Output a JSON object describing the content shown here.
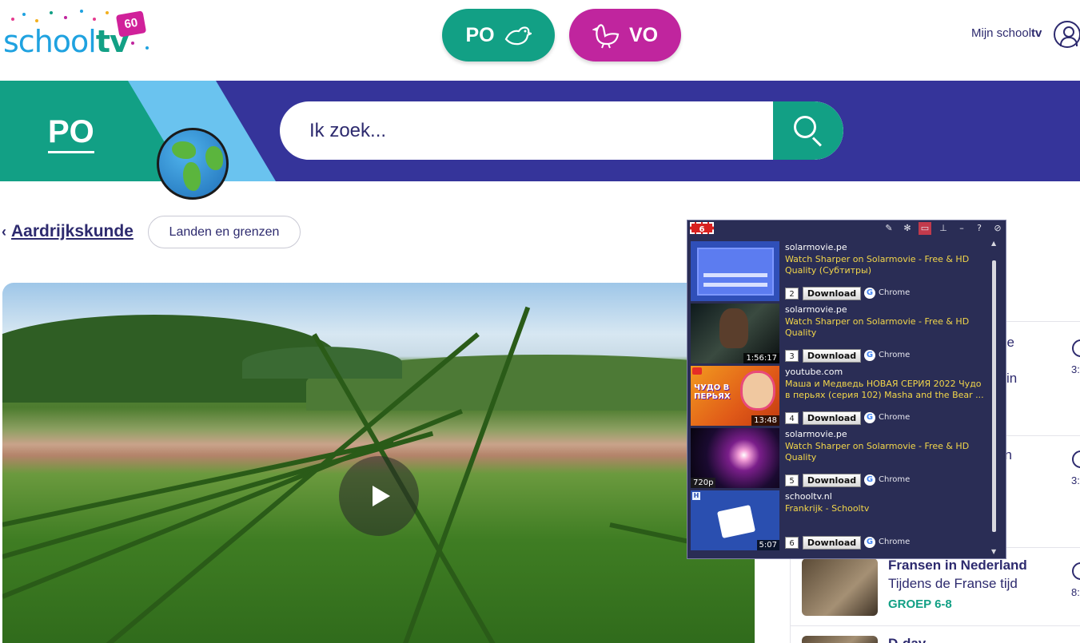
{
  "header": {
    "logo_text_a": "school",
    "logo_text_b": "tv",
    "logo_badge": "60",
    "po_label": "PO",
    "vo_label": "VO",
    "mijn_a": "Mijn school",
    "mijn_b": "tv"
  },
  "banner": {
    "po_label": "PO",
    "search_placeholder": "Ik zoek..."
  },
  "breadcrumb": {
    "back_label": "Aardrijkskunde",
    "tag_label": "Landen en grenzen"
  },
  "side_list": {
    "frag_1a": "se",
    "frag_1b": "jd in",
    "dur_1": "3:",
    "frag_2a": "en",
    "dur_2": "3:",
    "item_title": "Fransen in Nederland",
    "item_sub": "Tijdens de Franse tijd",
    "item_group": "GROEP 6-8",
    "dur_3": "8:",
    "frag_4": "D-day"
  },
  "popup": {
    "count": "6",
    "items": [
      {
        "num": "2",
        "domain": "solarmovie.pe",
        "title": "Watch Sharper on Solarmovie - Free & HD Quality (Субтитры)",
        "duration": "",
        "quality": "",
        "download": "Download",
        "browser": "Chrome"
      },
      {
        "num": "3",
        "domain": "solarmovie.pe",
        "title": "Watch Sharper on Solarmovie - Free & HD Quality",
        "duration": "1:56:17",
        "quality": "",
        "download": "Download",
        "browser": "Chrome"
      },
      {
        "num": "4",
        "domain": "youtube.com",
        "title": "Маша и Медведь НОВАЯ СЕРИЯ 2022 Чудо в перьях (серия 102) Masha and the Bear ...",
        "duration": "13:48",
        "quality": "",
        "download": "Download",
        "browser": "Chrome"
      },
      {
        "num": "5",
        "domain": "solarmovie.pe",
        "title": "Watch Sharper on Solarmovie - Free & HD Quality",
        "duration": "",
        "quality": "720p",
        "download": "Download",
        "browser": "Chrome"
      },
      {
        "num": "6",
        "domain": "schooltv.nl",
        "title": "Frankrijk - Schooltv",
        "duration": "5:07",
        "quality": "",
        "download": "Download",
        "browser": "Chrome"
      }
    ],
    "thumb_text_4": "ЧУДО В ПЕРЬЯХ"
  },
  "colors": {
    "po_green": "#12a085",
    "vo_magenta": "#c0259e",
    "banner_navy": "#35349a",
    "text_navy": "#2d2a6e",
    "popup_bg": "#2a2d55",
    "popup_title": "#f2d64a"
  }
}
